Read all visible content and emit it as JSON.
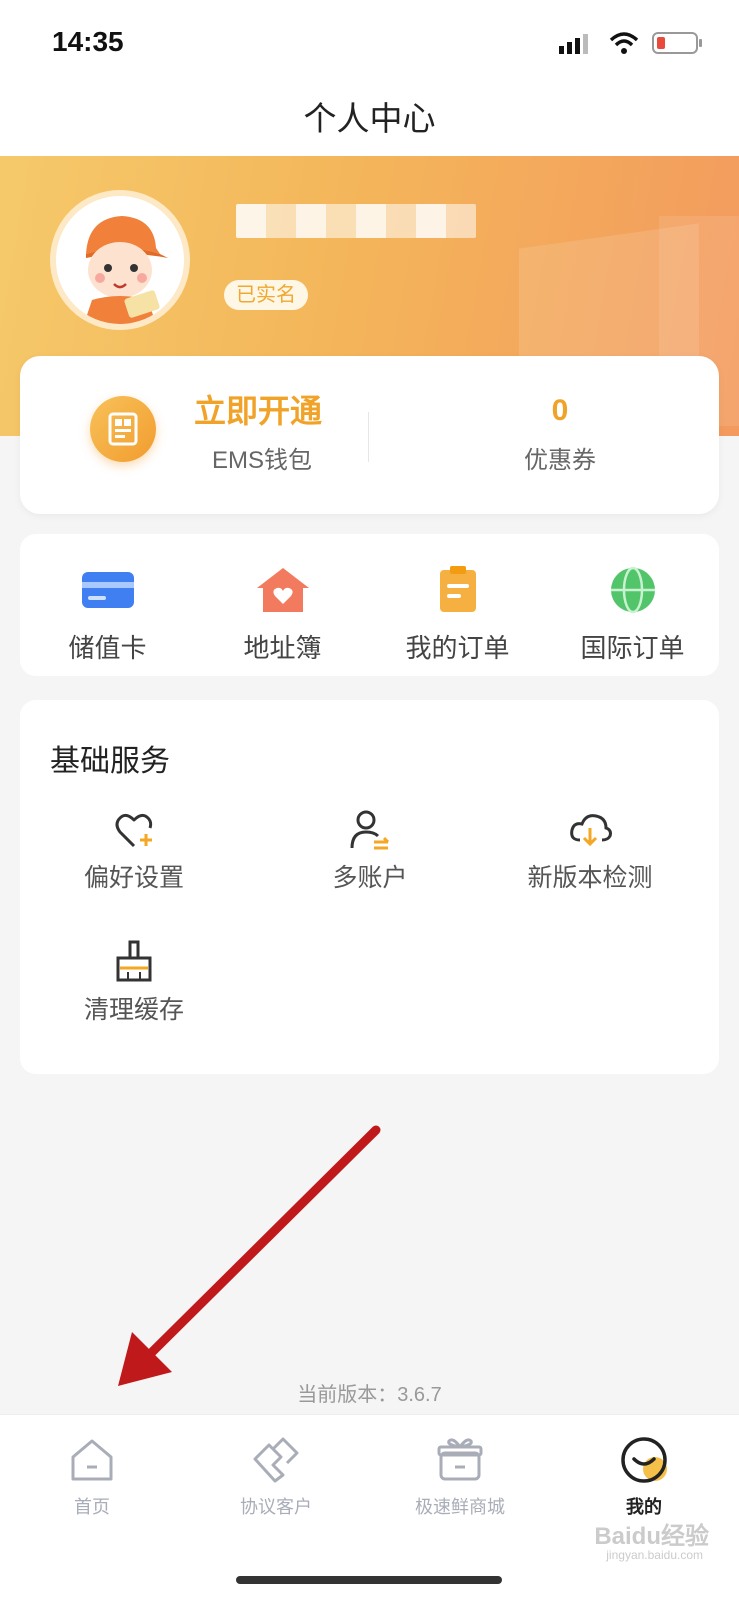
{
  "status_bar": {
    "time": "14:35",
    "battery_color": "#e84a3b"
  },
  "nav": {
    "title": "个人中心"
  },
  "profile": {
    "verified_label": "已实名"
  },
  "wallet": {
    "title": "立即开通",
    "subtitle": "EMS钱包",
    "coupon_count": "0",
    "coupon_label": "优惠券"
  },
  "quick_links": [
    {
      "label": "储值卡",
      "icon": "card-icon"
    },
    {
      "label": "地址簿",
      "icon": "house-heart-icon"
    },
    {
      "label": "我的订单",
      "icon": "clipboard-icon"
    },
    {
      "label": "国际订单",
      "icon": "globe-icon"
    }
  ],
  "services": {
    "title": "基础服务",
    "items": [
      {
        "label": "偏好设置",
        "icon": "heart-plus-icon"
      },
      {
        "label": "多账户",
        "icon": "user-switch-icon"
      },
      {
        "label": "新版本检测",
        "icon": "cloud-download-icon"
      },
      {
        "label": "清理缓存",
        "icon": "broom-icon"
      }
    ]
  },
  "version_text": "当前版本：3.6.7",
  "tabs": [
    {
      "label": "首页",
      "icon": "home-icon",
      "active": false
    },
    {
      "label": "协议客户",
      "icon": "handshake-icon",
      "active": false
    },
    {
      "label": "极速鲜商城",
      "icon": "gift-icon",
      "active": false
    },
    {
      "label": "我的",
      "icon": "smile-icon",
      "active": true
    }
  ],
  "watermark": {
    "brand": "Baidu经验",
    "site": "jingyan.baidu.com"
  },
  "colors": {
    "accent": "#f0a328",
    "annotation_arrow": "#c0191c"
  }
}
